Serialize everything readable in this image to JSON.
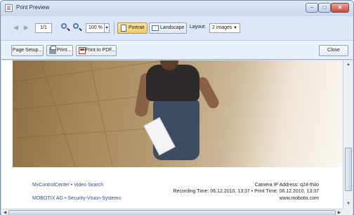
{
  "window": {
    "title": "Print Preview",
    "controls": {
      "minimize": "–",
      "maximize": "□",
      "close": "✕"
    }
  },
  "toolbar": {
    "page_indicator": "1/1",
    "zoom_value": "100 %",
    "portrait_label": "Portrait",
    "landscape_label": "Landscape",
    "layout_label": "Layout:",
    "layout_value": "2 images",
    "orientation_selected": "Portrait"
  },
  "actions": {
    "page_setup": "Page Setup...",
    "print": "Print...",
    "print_to_pdf": "Print to PDF...",
    "close": "Close"
  },
  "preview": {
    "footer_left_line1": "MxControlCenter • Video Search",
    "footer_left_line2": "MOBOTIX AG • Security-Vision-Systems",
    "footer_right_line1": "Camera IP Address: q24-thilo",
    "footer_right_line2": "Recording Time: 06.12.2010, 13:37 • Print Time: 06.12.2010, 13:37",
    "footer_right_line3": "www.mobotix.com"
  },
  "colors": {
    "accent_active": "#f4c867",
    "footer_link": "#2c4f8c",
    "titlebar": "#c6d9ef"
  },
  "icons": [
    "app-icon",
    "back-arrow-icon",
    "forward-arrow-icon",
    "zoom-in-icon",
    "zoom-out-icon",
    "portrait-icon",
    "landscape-icon",
    "print-icon",
    "pdf-icon"
  ]
}
